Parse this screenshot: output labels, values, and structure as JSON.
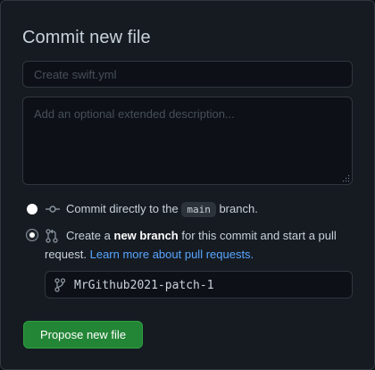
{
  "form": {
    "title": "Commit new file",
    "summary": {
      "value": "",
      "placeholder": "Create swift.yml"
    },
    "description": {
      "value": "",
      "placeholder": "Add an optional extended description..."
    }
  },
  "options": {
    "direct": {
      "selected": true,
      "text_before": "Commit directly to the",
      "branch": "main",
      "text_after": "branch.",
      "icon": "git-commit-icon"
    },
    "new_branch": {
      "selected": false,
      "text_before": "Create a",
      "bold": "new branch",
      "text_line1_after": "for this commit and start a pull",
      "text_line2": "request.",
      "link": "Learn more about pull requests.",
      "icon": "git-pull-request-icon",
      "branch_name": "MrGithub2021-patch-1",
      "branch_icon": "git-branch-icon"
    }
  },
  "actions": {
    "submit_label": "Propose new file"
  },
  "colors": {
    "background": "#161b22",
    "input_bg": "#0d1117",
    "border": "#30363d",
    "text": "#c9d1d9",
    "link": "#58a6ff",
    "primary_button": "#238636"
  }
}
